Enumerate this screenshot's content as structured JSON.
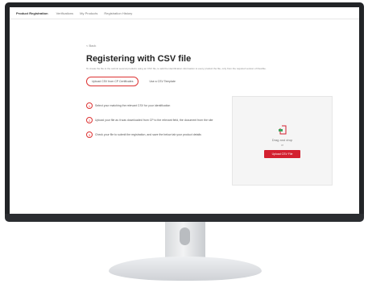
{
  "nav": {
    "brand": "Product Registration",
    "links": [
      "Verifications",
      "My Products",
      "Registration History"
    ]
  },
  "back_label": "< Back",
  "page": {
    "title": "Registering with CSV file",
    "subtitle": "To create the file to the submit several products using an CSV file, to add the identification information to every product the file, only from the required version of Flexible."
  },
  "tabs": [
    "Upload CSV from CP Certificates",
    "Use a CSV Template"
  ],
  "steps": [
    "Select your matching the relevant CSV for your identification",
    "Upload your file as it was downloaded from CP to the relevant field, the document from the site",
    "Check your file to submit the registration, and save the below tab your product details"
  ],
  "upload": {
    "drop_label": "Drag and drop",
    "or_label": "or",
    "button_label": "Upload CSV File"
  },
  "colors": {
    "accent": "#d3202f"
  }
}
